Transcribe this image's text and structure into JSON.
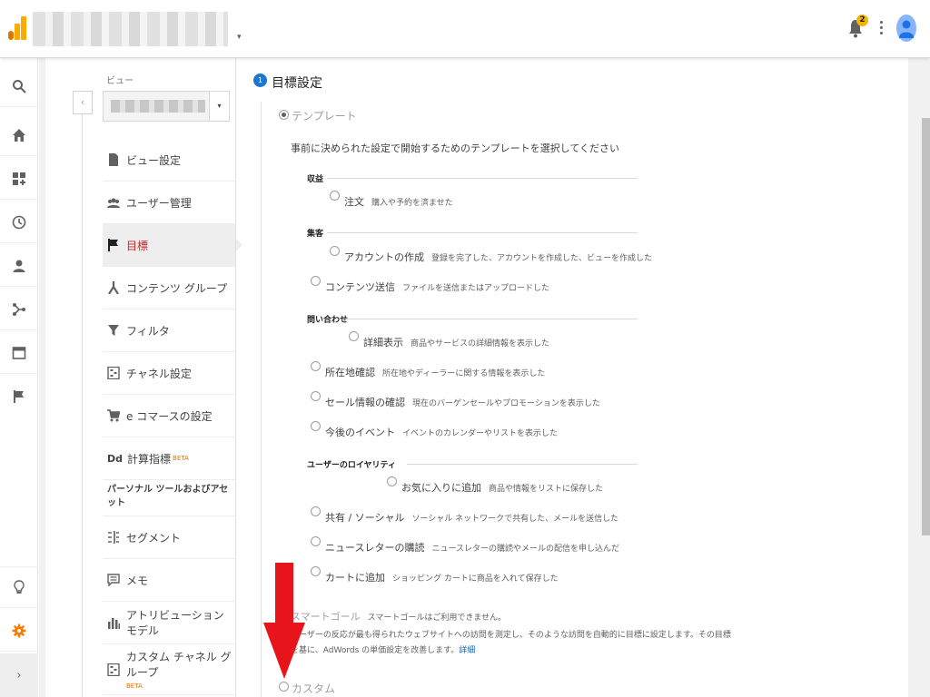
{
  "header": {
    "notification_count": "2",
    "account_selector_caret": "▾"
  },
  "rail": {
    "icons": [
      "search-icon",
      "home-icon",
      "dashboard-icon",
      "realtime-clock-icon",
      "audience-person-icon",
      "acquisition-icon",
      "behavior-icon",
      "conversions-flag-icon"
    ],
    "bottom_icons": [
      "discover-lightbulb-icon",
      "admin-gear-icon"
    ],
    "expand_label": "›"
  },
  "view": {
    "label": "ビュー",
    "caret": "▾",
    "collapse": "‹"
  },
  "nav": {
    "items": [
      {
        "label": "ビュー設定"
      },
      {
        "label": "ユーザー管理"
      },
      {
        "label": "目標"
      },
      {
        "label": "コンテンツ グループ"
      },
      {
        "label": "フィルタ"
      },
      {
        "label": "チャネル設定"
      },
      {
        "label": "e コマースの設定"
      },
      {
        "label": "計算指標",
        "badge": "BETA",
        "prefix": "Dd"
      }
    ],
    "section_title": "パーソナル ツールおよびアセット",
    "personal_items": [
      {
        "label": "セグメント"
      },
      {
        "label": "メモ"
      },
      {
        "label": "アトリビューション モデル"
      },
      {
        "label": "カスタム チャネル グループ",
        "badge": "BETA"
      }
    ]
  },
  "goal_setup": {
    "step_number": "1",
    "step_title": "目標設定",
    "template_option": "テンプレート",
    "template_desc": "事前に決められた設定で開始するためのテンプレートを選択してください",
    "categories": [
      {
        "title": "収益",
        "goals": [
          {
            "name": "注文",
            "desc": "購入や予約を済ませた"
          }
        ]
      },
      {
        "title": "集客",
        "goals": [
          {
            "name": "アカウントの作成",
            "desc": "登録を完了した、アカウントを作成した、ビューを作成した"
          },
          {
            "name": "コンテンツ送信",
            "desc": "ファイルを送信またはアップロードした"
          }
        ]
      },
      {
        "title": "問い合わせ",
        "goals": [
          {
            "name": "詳細表示",
            "desc": "商品やサービスの詳細情報を表示した"
          },
          {
            "name": "所在地確認",
            "desc": "所在地やディーラーに関する情報を表示した"
          },
          {
            "name": "セール情報の確認",
            "desc": "現在のバーゲンセールやプロモーションを表示した"
          },
          {
            "name": "今後のイベント",
            "desc": "イベントのカレンダーやリストを表示した"
          }
        ]
      },
      {
        "title": "ユーザーのロイヤリティ",
        "goals": [
          {
            "name": "お気に入りに追加",
            "desc": "商品や情報をリストに保存した"
          },
          {
            "name": "共有 / ソーシャル",
            "desc": "ソーシャル ネットワークで共有した、メールを送信した"
          },
          {
            "name": "ニュースレターの購読",
            "desc": "ニュースレターの購読やメールの配信を申し込んだ"
          },
          {
            "name": "カートに追加",
            "desc": "ショッピング カートに商品を入れて保存した"
          }
        ]
      }
    ],
    "smart_goal_option": "スマートゴール",
    "smart_goal_status": "スマートゴールはご利用できません。",
    "smart_goal_desc_1": "ユーザーの反応が最も得られたウェブサイトへの訪問を測定し、そのような訪問を自動的に目標に設定します。その目標",
    "smart_goal_desc_2": "を基に、AdWords の単価設定を改善します。",
    "smart_goal_link": "詳細",
    "custom_option": "カスタム"
  },
  "colors": {
    "accent_blue": "#1976d2",
    "active_red": "#c62828",
    "annotation_arrow": "#e8141b",
    "admin_orange": "#f57c00"
  }
}
